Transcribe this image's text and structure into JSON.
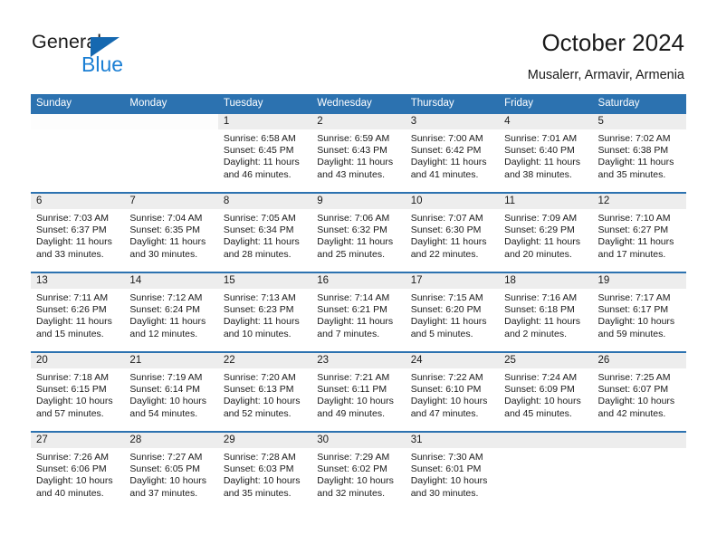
{
  "brand": {
    "name_primary": "General",
    "name_secondary": "Blue",
    "primary_color": "#1c1c1c",
    "secondary_color": "#1B7FD4",
    "triangle_color": "#1568B0"
  },
  "header": {
    "title": "October 2024",
    "subtitle": "Musalerr, Armavir, Armenia"
  },
  "theme": {
    "header_blue": "#2C72B0",
    "daynum_band": "#EDEDED",
    "cell_background": "#FFFFFF"
  },
  "weekdays": [
    "Sunday",
    "Monday",
    "Tuesday",
    "Wednesday",
    "Thursday",
    "Friday",
    "Saturday"
  ],
  "weeks": [
    {
      "days": [
        {
          "number": "",
          "lines": [
            "",
            "",
            "",
            ""
          ],
          "blank": true
        },
        {
          "number": "",
          "lines": [
            "",
            "",
            "",
            ""
          ],
          "blank": true
        },
        {
          "number": "1",
          "lines": [
            "Sunrise: 6:58 AM",
            "Sunset: 6:45 PM",
            "Daylight: 11 hours",
            "and 46 minutes."
          ]
        },
        {
          "number": "2",
          "lines": [
            "Sunrise: 6:59 AM",
            "Sunset: 6:43 PM",
            "Daylight: 11 hours",
            "and 43 minutes."
          ]
        },
        {
          "number": "3",
          "lines": [
            "Sunrise: 7:00 AM",
            "Sunset: 6:42 PM",
            "Daylight: 11 hours",
            "and 41 minutes."
          ]
        },
        {
          "number": "4",
          "lines": [
            "Sunrise: 7:01 AM",
            "Sunset: 6:40 PM",
            "Daylight: 11 hours",
            "and 38 minutes."
          ]
        },
        {
          "number": "5",
          "lines": [
            "Sunrise: 7:02 AM",
            "Sunset: 6:38 PM",
            "Daylight: 11 hours",
            "and 35 minutes."
          ]
        }
      ]
    },
    {
      "days": [
        {
          "number": "6",
          "lines": [
            "Sunrise: 7:03 AM",
            "Sunset: 6:37 PM",
            "Daylight: 11 hours",
            "and 33 minutes."
          ]
        },
        {
          "number": "7",
          "lines": [
            "Sunrise: 7:04 AM",
            "Sunset: 6:35 PM",
            "Daylight: 11 hours",
            "and 30 minutes."
          ]
        },
        {
          "number": "8",
          "lines": [
            "Sunrise: 7:05 AM",
            "Sunset: 6:34 PM",
            "Daylight: 11 hours",
            "and 28 minutes."
          ]
        },
        {
          "number": "9",
          "lines": [
            "Sunrise: 7:06 AM",
            "Sunset: 6:32 PM",
            "Daylight: 11 hours",
            "and 25 minutes."
          ]
        },
        {
          "number": "10",
          "lines": [
            "Sunrise: 7:07 AM",
            "Sunset: 6:30 PM",
            "Daylight: 11 hours",
            "and 22 minutes."
          ]
        },
        {
          "number": "11",
          "lines": [
            "Sunrise: 7:09 AM",
            "Sunset: 6:29 PM",
            "Daylight: 11 hours",
            "and 20 minutes."
          ]
        },
        {
          "number": "12",
          "lines": [
            "Sunrise: 7:10 AM",
            "Sunset: 6:27 PM",
            "Daylight: 11 hours",
            "and 17 minutes."
          ]
        }
      ]
    },
    {
      "days": [
        {
          "number": "13",
          "lines": [
            "Sunrise: 7:11 AM",
            "Sunset: 6:26 PM",
            "Daylight: 11 hours",
            "and 15 minutes."
          ]
        },
        {
          "number": "14",
          "lines": [
            "Sunrise: 7:12 AM",
            "Sunset: 6:24 PM",
            "Daylight: 11 hours",
            "and 12 minutes."
          ]
        },
        {
          "number": "15",
          "lines": [
            "Sunrise: 7:13 AM",
            "Sunset: 6:23 PM",
            "Daylight: 11 hours",
            "and 10 minutes."
          ]
        },
        {
          "number": "16",
          "lines": [
            "Sunrise: 7:14 AM",
            "Sunset: 6:21 PM",
            "Daylight: 11 hours",
            "and 7 minutes."
          ]
        },
        {
          "number": "17",
          "lines": [
            "Sunrise: 7:15 AM",
            "Sunset: 6:20 PM",
            "Daylight: 11 hours",
            "and 5 minutes."
          ]
        },
        {
          "number": "18",
          "lines": [
            "Sunrise: 7:16 AM",
            "Sunset: 6:18 PM",
            "Daylight: 11 hours",
            "and 2 minutes."
          ]
        },
        {
          "number": "19",
          "lines": [
            "Sunrise: 7:17 AM",
            "Sunset: 6:17 PM",
            "Daylight: 10 hours",
            "and 59 minutes."
          ]
        }
      ]
    },
    {
      "days": [
        {
          "number": "20",
          "lines": [
            "Sunrise: 7:18 AM",
            "Sunset: 6:15 PM",
            "Daylight: 10 hours",
            "and 57 minutes."
          ]
        },
        {
          "number": "21",
          "lines": [
            "Sunrise: 7:19 AM",
            "Sunset: 6:14 PM",
            "Daylight: 10 hours",
            "and 54 minutes."
          ]
        },
        {
          "number": "22",
          "lines": [
            "Sunrise: 7:20 AM",
            "Sunset: 6:13 PM",
            "Daylight: 10 hours",
            "and 52 minutes."
          ]
        },
        {
          "number": "23",
          "lines": [
            "Sunrise: 7:21 AM",
            "Sunset: 6:11 PM",
            "Daylight: 10 hours",
            "and 49 minutes."
          ]
        },
        {
          "number": "24",
          "lines": [
            "Sunrise: 7:22 AM",
            "Sunset: 6:10 PM",
            "Daylight: 10 hours",
            "and 47 minutes."
          ]
        },
        {
          "number": "25",
          "lines": [
            "Sunrise: 7:24 AM",
            "Sunset: 6:09 PM",
            "Daylight: 10 hours",
            "and 45 minutes."
          ]
        },
        {
          "number": "26",
          "lines": [
            "Sunrise: 7:25 AM",
            "Sunset: 6:07 PM",
            "Daylight: 10 hours",
            "and 42 minutes."
          ]
        }
      ]
    },
    {
      "days": [
        {
          "number": "27",
          "lines": [
            "Sunrise: 7:26 AM",
            "Sunset: 6:06 PM",
            "Daylight: 10 hours",
            "and 40 minutes."
          ]
        },
        {
          "number": "28",
          "lines": [
            "Sunrise: 7:27 AM",
            "Sunset: 6:05 PM",
            "Daylight: 10 hours",
            "and 37 minutes."
          ]
        },
        {
          "number": "29",
          "lines": [
            "Sunrise: 7:28 AM",
            "Sunset: 6:03 PM",
            "Daylight: 10 hours",
            "and 35 minutes."
          ]
        },
        {
          "number": "30",
          "lines": [
            "Sunrise: 7:29 AM",
            "Sunset: 6:02 PM",
            "Daylight: 10 hours",
            "and 32 minutes."
          ]
        },
        {
          "number": "31",
          "lines": [
            "Sunrise: 7:30 AM",
            "Sunset: 6:01 PM",
            "Daylight: 10 hours",
            "and 30 minutes."
          ]
        },
        {
          "number": "",
          "lines": [
            "",
            "",
            "",
            ""
          ],
          "empty": true
        },
        {
          "number": "",
          "lines": [
            "",
            "",
            "",
            ""
          ],
          "empty": true
        }
      ]
    }
  ]
}
